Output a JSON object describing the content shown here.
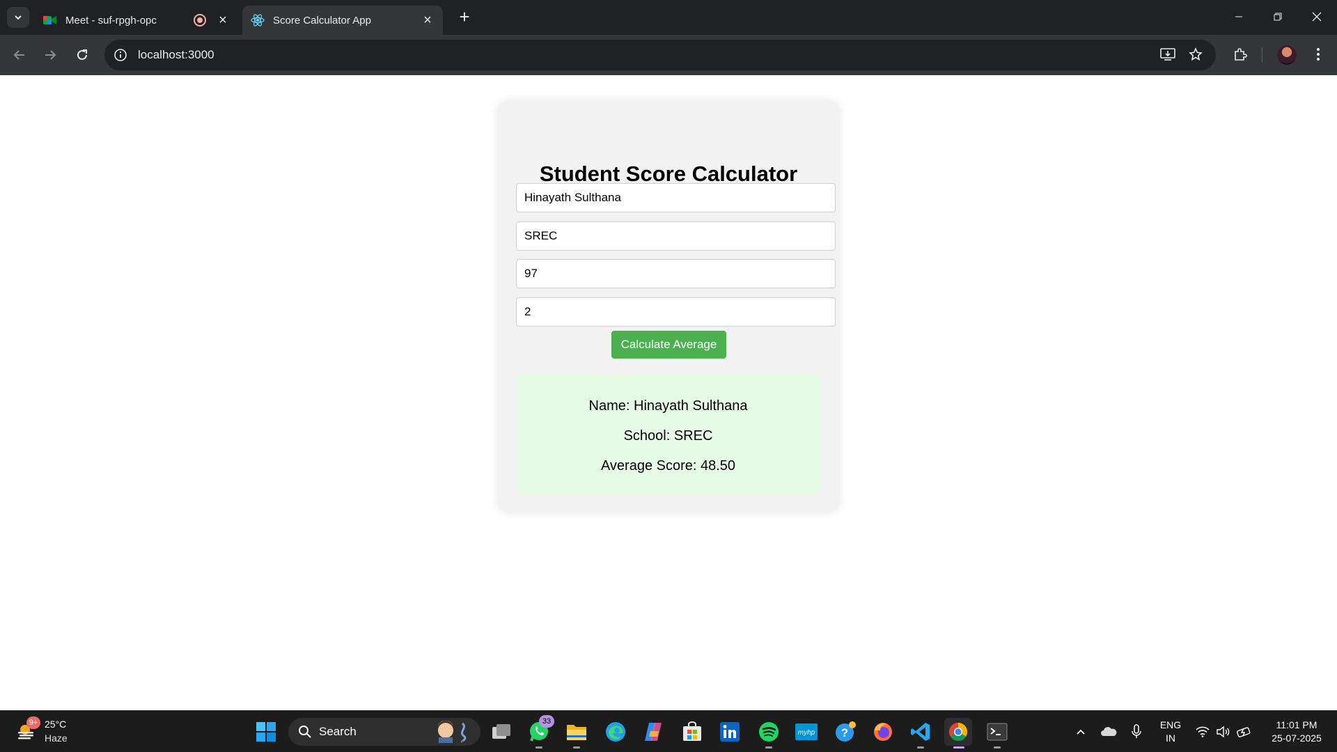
{
  "browser": {
    "tabs": [
      {
        "title": "Meet - suf-rpgh-opc",
        "favicon": "google-meet-icon",
        "recording": true
      },
      {
        "title": "Score Calculator App",
        "favicon": "react-icon",
        "active": true
      }
    ],
    "url": "localhost:3000"
  },
  "app": {
    "heading": "Student Score Calculator",
    "fields": {
      "name": "Hinayath Sulthana",
      "school": "SREC",
      "score1": "97",
      "score2": "2"
    },
    "button_label": "Calculate Average",
    "result": {
      "name_line": "Name: Hinayath Sulthana",
      "school_line": "School: SREC",
      "average_line": "Average Score: 48.50"
    },
    "colors": {
      "button": "#4caf50",
      "result_bg": "#e5fbe5"
    }
  },
  "taskbar": {
    "weather": {
      "badge": "9+",
      "temp": "25°C",
      "desc": "Haze"
    },
    "search_label": "Search",
    "whatsapp_badge": "33",
    "language": {
      "line1": "ENG",
      "line2": "IN"
    },
    "time": "11:01 PM",
    "date": "25-07-2025"
  }
}
